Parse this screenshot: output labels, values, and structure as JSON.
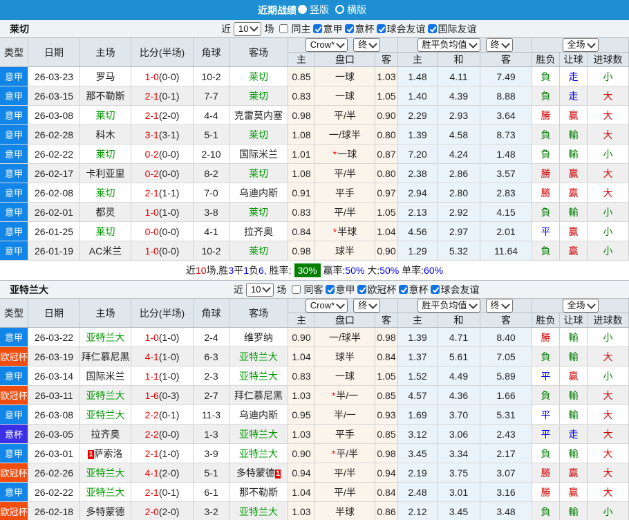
{
  "topbar": {
    "title": "近期战绩",
    "layout_options": [
      {
        "label": "竖版",
        "selected": true
      },
      {
        "label": "横版",
        "selected": false
      }
    ]
  },
  "colors": {
    "topbar": "#1e8fd2",
    "league": {
      "意甲": "#1286e8",
      "欧冠杯": "#f04e11",
      "意杯": "#3c30e6"
    },
    "score_red": "#e60000",
    "win_red": "#d10000",
    "lose_green": "#007c00",
    "draw_blue": "#0000e0",
    "team_green": "#009900",
    "summary_badge_green": "#008000"
  },
  "columns": {
    "main": [
      "类型",
      "日期",
      "主场",
      "比分(半场)",
      "角球",
      "客场"
    ],
    "sub": [
      "主",
      "盘口",
      "客",
      "主",
      "和",
      "客",
      "胜负",
      "让球",
      "进球数"
    ]
  },
  "sections": [
    {
      "team": "莱切",
      "filters": {
        "near": "近",
        "count": "10",
        "matches": "场",
        "same": {
          "label": "同主",
          "checked": false
        },
        "leagues": [
          {
            "label": "意甲",
            "checked": true
          },
          {
            "label": "意杯",
            "checked": true
          },
          {
            "label": "球会友谊",
            "checked": true
          },
          {
            "label": "国际友谊",
            "checked": true
          }
        ]
      },
      "selects": {
        "asian_company": "Crow*",
        "asian_time": "终",
        "euro_company": "胜平负均值",
        "euro_time": "终",
        "scope": "全场"
      },
      "rows": [
        {
          "league": "意甲",
          "date": "26-03-23",
          "home": "罗马",
          "home_card": null,
          "score": "1-0",
          "half": "(0-0)",
          "corners": "10-2",
          "away": "莱切",
          "away_card": null,
          "asian_home": "0.85",
          "handicap_star": null,
          "handicap": "一球",
          "asian_away": "1.03",
          "euro_home": "1.48",
          "euro_draw": "4.11",
          "euro_away": "7.49",
          "wdl": "負",
          "handicap_result": "走",
          "goals": "小"
        },
        {
          "league": "意甲",
          "date": "26-03-15",
          "home": "那不勒斯",
          "home_card": null,
          "score": "2-1",
          "half": "(0-1)",
          "corners": "7-7",
          "away": "莱切",
          "away_card": null,
          "asian_home": "0.83",
          "handicap_star": null,
          "handicap": "一球",
          "asian_away": "1.05",
          "euro_home": "1.40",
          "euro_draw": "4.39",
          "euro_away": "8.88",
          "wdl": "負",
          "handicap_result": "走",
          "goals": "大"
        },
        {
          "league": "意甲",
          "date": "26-03-08",
          "home": "莱切",
          "home_card": null,
          "score": "2-1",
          "half": "(2-0)",
          "corners": "4-4",
          "away": "克雷莫内塞",
          "away_card": null,
          "asian_home": "0.98",
          "handicap_star": null,
          "handicap": "平/半",
          "asian_away": "0.90",
          "euro_home": "2.29",
          "euro_draw": "2.93",
          "euro_away": "3.64",
          "wdl": "勝",
          "handicap_result": "贏",
          "goals": "大"
        },
        {
          "league": "意甲",
          "date": "26-02-28",
          "home": "科木",
          "home_card": null,
          "score": "3-1",
          "half": "(3-1)",
          "corners": "5-1",
          "away": "莱切",
          "away_card": null,
          "asian_home": "1.08",
          "handicap_star": null,
          "handicap": "一/球半",
          "asian_away": "0.80",
          "euro_home": "1.39",
          "euro_draw": "4.58",
          "euro_away": "8.73",
          "wdl": "負",
          "handicap_result": "輸",
          "goals": "大"
        },
        {
          "league": "意甲",
          "date": "26-02-22",
          "home": "莱切",
          "home_card": null,
          "score": "0-2",
          "half": "(0-0)",
          "corners": "2-10",
          "away": "国际米兰",
          "away_card": null,
          "asian_home": "1.01",
          "handicap_star": "*",
          "handicap": "一球",
          "asian_away": "0.87",
          "euro_home": "7.20",
          "euro_draw": "4.24",
          "euro_away": "1.48",
          "wdl": "負",
          "handicap_result": "輸",
          "goals": "小"
        },
        {
          "league": "意甲",
          "date": "26-02-17",
          "home": "卡利亚里",
          "home_card": null,
          "score": "0-2",
          "half": "(0-0)",
          "corners": "8-2",
          "away": "莱切",
          "away_card": null,
          "asian_home": "1.08",
          "handicap_star": null,
          "handicap": "平/半",
          "asian_away": "0.80",
          "euro_home": "2.38",
          "euro_draw": "2.86",
          "euro_away": "3.57",
          "wdl": "勝",
          "handicap_result": "贏",
          "goals": "大"
        },
        {
          "league": "意甲",
          "date": "26-02-08",
          "home": "莱切",
          "home_card": null,
          "score": "2-1",
          "half": "(1-1)",
          "corners": "7-0",
          "away": "乌迪内斯",
          "away_card": null,
          "asian_home": "0.91",
          "handicap_star": null,
          "handicap": "平手",
          "asian_away": "0.97",
          "euro_home": "2.94",
          "euro_draw": "2.80",
          "euro_away": "2.83",
          "wdl": "勝",
          "handicap_result": "贏",
          "goals": "大"
        },
        {
          "league": "意甲",
          "date": "26-02-01",
          "home": "都灵",
          "home_card": null,
          "score": "1-0",
          "half": "(1-0)",
          "corners": "3-8",
          "away": "莱切",
          "away_card": null,
          "asian_home": "0.83",
          "handicap_star": null,
          "handicap": "平/半",
          "asian_away": "1.05",
          "euro_home": "2.13",
          "euro_draw": "2.92",
          "euro_away": "4.15",
          "wdl": "負",
          "handicap_result": "輸",
          "goals": "小"
        },
        {
          "league": "意甲",
          "date": "26-01-25",
          "home": "莱切",
          "home_card": null,
          "score": "0-0",
          "half": "(0-0)",
          "corners": "4-1",
          "away": "拉齐奥",
          "away_card": null,
          "asian_home": "0.84",
          "handicap_star": "*",
          "handicap": "半球",
          "asian_away": "1.04",
          "euro_home": "4.56",
          "euro_draw": "2.97",
          "euro_away": "2.01",
          "wdl": "平",
          "handicap_result": "贏",
          "goals": "小"
        },
        {
          "league": "意甲",
          "date": "26-01-19",
          "home": "AC米兰",
          "home_card": null,
          "score": "1-0",
          "half": "(0-0)",
          "corners": "10-2",
          "away": "莱切",
          "away_card": null,
          "asian_home": "0.98",
          "handicap_star": null,
          "handicap": "球半",
          "asian_away": "0.90",
          "euro_home": "1.29",
          "euro_draw": "5.32",
          "euro_away": "11.64",
          "wdl": "負",
          "handicap_result": "贏",
          "goals": "小"
        }
      ],
      "summary": [
        {
          "t": "近",
          "c": "k"
        },
        {
          "t": "10",
          "c": "r"
        },
        {
          "t": "场,胜",
          "c": "k"
        },
        {
          "t": "3",
          "c": "b"
        },
        {
          "t": "平",
          "c": "k"
        },
        {
          "t": "1",
          "c": "b"
        },
        {
          "t": "负",
          "c": "k"
        },
        {
          "t": "6",
          "c": "b"
        },
        {
          "t": ", 胜率:",
          "c": "k"
        },
        {
          "t": "30%",
          "c": "badge"
        },
        {
          "t": "赢率:",
          "c": "k"
        },
        {
          "t": "50%",
          "c": "b"
        },
        {
          "t": " 大:",
          "c": "k"
        },
        {
          "t": "50%",
          "c": "b"
        },
        {
          "t": " 单率:",
          "c": "k"
        },
        {
          "t": "60%",
          "c": "b"
        }
      ]
    },
    {
      "team": "亚特兰大",
      "filters": {
        "near": "近",
        "count": "10",
        "matches": "场",
        "same": {
          "label": "同客",
          "checked": false
        },
        "leagues": [
          {
            "label": "意甲",
            "checked": true
          },
          {
            "label": "欧冠杯",
            "checked": true
          },
          {
            "label": "意杯",
            "checked": true
          },
          {
            "label": "球会友谊",
            "checked": true
          }
        ]
      },
      "selects": {
        "asian_company": "Crow*",
        "asian_time": "终",
        "euro_company": "胜平负均值",
        "euro_time": "终",
        "scope": "全场"
      },
      "rows": [
        {
          "league": "意甲",
          "date": "26-03-22",
          "home": "亚特兰大",
          "home_card": null,
          "score": "1-0",
          "half": "(1-0)",
          "corners": "2-4",
          "away": "维罗纳",
          "away_card": null,
          "asian_home": "0.90",
          "handicap_star": null,
          "handicap": "一/球半",
          "asian_away": "0.98",
          "euro_home": "1.39",
          "euro_draw": "4.71",
          "euro_away": "8.40",
          "wdl": "勝",
          "handicap_result": "輸",
          "goals": "小"
        },
        {
          "league": "欧冠杯",
          "date": "26-03-19",
          "home": "拜仁慕尼黑",
          "home_card": null,
          "score": "4-1",
          "half": "(1-0)",
          "corners": "6-3",
          "away": "亚特兰大",
          "away_card": null,
          "asian_home": "1.04",
          "handicap_star": null,
          "handicap": "球半",
          "asian_away": "0.84",
          "euro_home": "1.37",
          "euro_draw": "5.61",
          "euro_away": "7.05",
          "wdl": "負",
          "handicap_result": "輸",
          "goals": "大"
        },
        {
          "league": "意甲",
          "date": "26-03-14",
          "home": "国际米兰",
          "home_card": null,
          "score": "1-1",
          "half": "(1-0)",
          "corners": "2-3",
          "away": "亚特兰大",
          "away_card": null,
          "asian_home": "0.83",
          "handicap_star": null,
          "handicap": "一球",
          "asian_away": "1.05",
          "euro_home": "1.52",
          "euro_draw": "4.49",
          "euro_away": "5.89",
          "wdl": "平",
          "handicap_result": "贏",
          "goals": "小"
        },
        {
          "league": "欧冠杯",
          "date": "26-03-11",
          "home": "亚特兰大",
          "home_card": null,
          "score": "1-6",
          "half": "(0-3)",
          "corners": "2-7",
          "away": "拜仁慕尼黑",
          "away_card": null,
          "asian_home": "1.03",
          "handicap_star": "*",
          "handicap": "半/一",
          "asian_away": "0.85",
          "euro_home": "4.57",
          "euro_draw": "4.36",
          "euro_away": "1.66",
          "wdl": "負",
          "handicap_result": "輸",
          "goals": "大"
        },
        {
          "league": "意甲",
          "date": "26-03-08",
          "home": "亚特兰大",
          "home_card": null,
          "score": "2-2",
          "half": "(0-1)",
          "corners": "11-3",
          "away": "乌迪内斯",
          "away_card": null,
          "asian_home": "0.95",
          "handicap_star": null,
          "handicap": "半/一",
          "asian_away": "0.93",
          "euro_home": "1.69",
          "euro_draw": "3.70",
          "euro_away": "5.31",
          "wdl": "平",
          "handicap_result": "輸",
          "goals": "大"
        },
        {
          "league": "意杯",
          "date": "26-03-05",
          "home": "拉齐奥",
          "home_card": null,
          "score": "2-2",
          "half": "(0-0)",
          "corners": "1-3",
          "away": "亚特兰大",
          "away_card": null,
          "asian_home": "1.03",
          "handicap_star": null,
          "handicap": "平手",
          "asian_away": "0.85",
          "euro_home": "3.12",
          "euro_draw": "3.06",
          "euro_away": "2.43",
          "wdl": "平",
          "handicap_result": "走",
          "goals": "大"
        },
        {
          "league": "意甲",
          "date": "26-03-01",
          "home": "萨索洛",
          "home_card": "1",
          "score": "2-1",
          "half": "(1-0)",
          "corners": "3-9",
          "away": "亚特兰大",
          "away_card": null,
          "asian_home": "0.90",
          "handicap_star": "*",
          "handicap": "平/半",
          "asian_away": "0.98",
          "euro_home": "3.45",
          "euro_draw": "3.34",
          "euro_away": "2.17",
          "wdl": "負",
          "handicap_result": "輸",
          "goals": "大"
        },
        {
          "league": "欧冠杯",
          "date": "26-02-26",
          "home": "亚特兰大",
          "home_card": null,
          "score": "4-1",
          "half": "(2-0)",
          "corners": "5-1",
          "away": "多特蒙德",
          "away_card": "1",
          "asian_home": "0.94",
          "handicap_star": null,
          "handicap": "平/半",
          "asian_away": "0.94",
          "euro_home": "2.19",
          "euro_draw": "3.75",
          "euro_away": "3.07",
          "wdl": "勝",
          "handicap_result": "贏",
          "goals": "大"
        },
        {
          "league": "意甲",
          "date": "26-02-22",
          "home": "亚特兰大",
          "home_card": null,
          "score": "2-1",
          "half": "(0-1)",
          "corners": "6-1",
          "away": "那不勒斯",
          "away_card": null,
          "asian_home": "1.04",
          "handicap_star": null,
          "handicap": "平/半",
          "asian_away": "0.84",
          "euro_home": "2.48",
          "euro_draw": "3.01",
          "euro_away": "3.16",
          "wdl": "勝",
          "handicap_result": "贏",
          "goals": "大"
        },
        {
          "league": "欧冠杯",
          "date": "26-02-18",
          "home": "多特蒙德",
          "home_card": null,
          "score": "2-0",
          "half": "(2-0)",
          "corners": "3-2",
          "away": "亚特兰大",
          "away_card": null,
          "asian_home": "1.03",
          "handicap_star": null,
          "handicap": "半球",
          "asian_away": "0.86",
          "euro_home": "2.12",
          "euro_draw": "3.45",
          "euro_away": "3.48",
          "wdl": "負",
          "handicap_result": "輸",
          "goals": "小"
        }
      ],
      "summary": null
    }
  ]
}
